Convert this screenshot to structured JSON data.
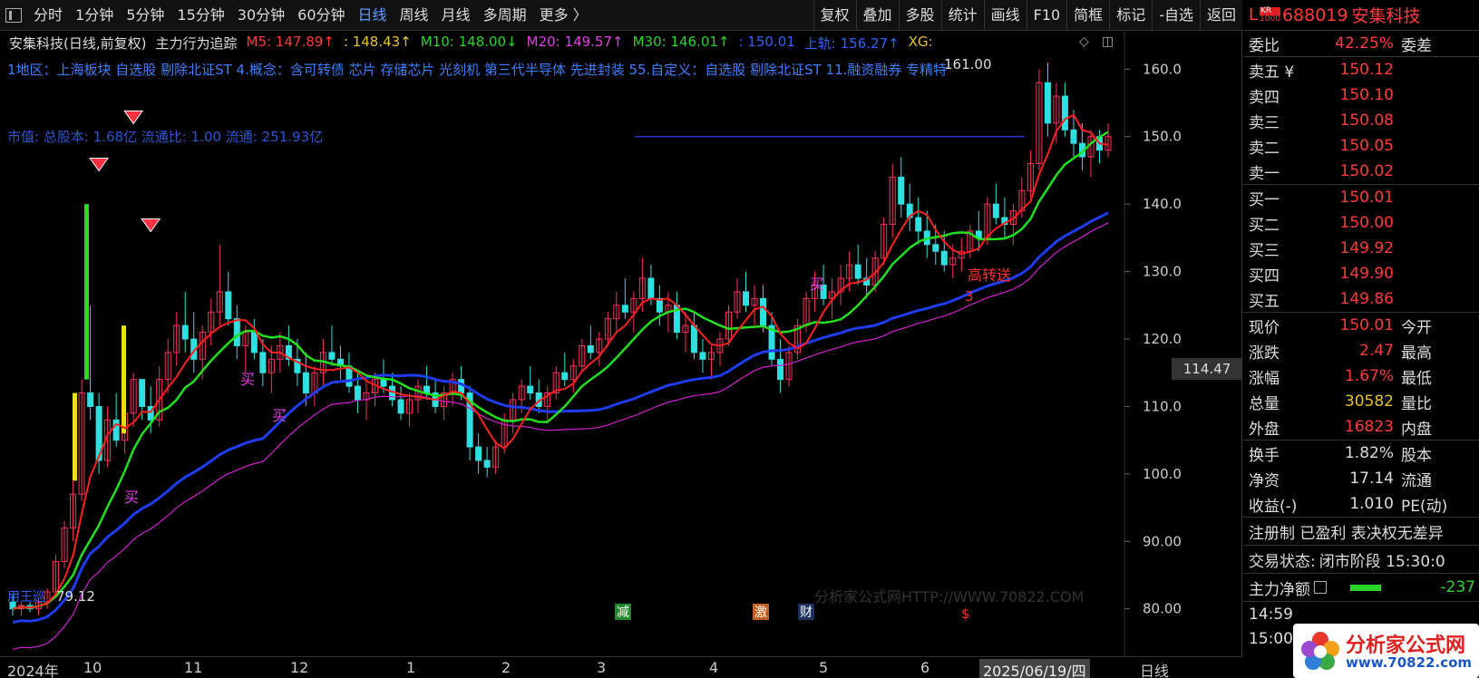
{
  "toolbar": {
    "left": [
      "分时",
      "1分钟",
      "5分钟",
      "15分钟",
      "30分钟",
      "60分钟",
      "日线",
      "周线",
      "月线",
      "多周期",
      "更多 〉"
    ],
    "active": "日线",
    "right": [
      "复权",
      "叠加",
      "多股",
      "统计",
      "画线",
      "F10",
      "简框",
      "标记",
      "-自选",
      "返回"
    ]
  },
  "legend": {
    "stock": "安集科技(日线,前复权)",
    "indicator": "主力行为追踪",
    "m5": "M5: 147.89↑",
    "m_unnamed": ": 148.43↑",
    "m10": "M10: 148.00↓",
    "m20": "M20: 149.57↑",
    "m30": "M30: 146.01↑",
    "val": ": 150.01",
    "upper": "上轨: 156.27↑",
    "xg": "XG:"
  },
  "concept_text": "1地区：上海板块  自选股  剔除北证ST  4.概念：含可转债  芯片  存储芯片  光刻机  第三代半导体  先进封装  55.自定义：自选股  剔除北证ST  11.融资融券  专精特",
  "cap_text": "市值: 总股本: 1.68亿 流通比: 1.00 流通: 251.93亿",
  "annotations": {
    "high_label": "161.00",
    "low_label": "79.12",
    "low_prefix": "用王巡",
    "buy": "买",
    "gzs": "高转送",
    "gzs_num": "3",
    "watermark": "分析家公式网HTTP://WWW.70822.COM",
    "event_jian": "减",
    "event_ji": "激",
    "event_cai": "财",
    "event_dollar": "$"
  },
  "price_tag": "114.47",
  "yaxis": [
    "160.0",
    "150.0",
    "140.0",
    "130.0",
    "120.0",
    "110.0",
    "100.0",
    "90.00",
    "80.00"
  ],
  "xaxis": {
    "labels": [
      "2024年",
      "10",
      "11",
      "12",
      "1",
      "2",
      "3",
      "4",
      "5",
      "6"
    ],
    "date": "2025/06/19/四",
    "period": "日线"
  },
  "panel": {
    "code_prefix": "L",
    "code_badge": "KR",
    "code_sub": "1000",
    "code": "688019",
    "name": "安集科技",
    "weibi_label": "委比",
    "weibi_val": "42.25%",
    "weicha_label": "委差",
    "sells": [
      {
        "label": "卖五 ¥",
        "price": "150.12"
      },
      {
        "label": "卖四",
        "price": "150.10"
      },
      {
        "label": "卖三",
        "price": "150.08"
      },
      {
        "label": "卖二",
        "price": "150.05"
      },
      {
        "label": "卖一",
        "price": "150.02"
      }
    ],
    "buys": [
      {
        "label": "买一",
        "price": "150.01"
      },
      {
        "label": "买二",
        "price": "150.00"
      },
      {
        "label": "买三",
        "price": "149.92"
      },
      {
        "label": "买四",
        "price": "149.90"
      },
      {
        "label": "买五",
        "price": "149.86"
      }
    ],
    "quote": [
      {
        "label": "现价",
        "val": "150.01",
        "cls": "red",
        "label2": "今开"
      },
      {
        "label": "涨跌",
        "val": "2.47",
        "cls": "red",
        "label2": "最高"
      },
      {
        "label": "涨幅",
        "val": "1.67%",
        "cls": "red",
        "label2": "最低"
      },
      {
        "label": "总量",
        "val": "30582",
        "cls": "yellow",
        "label2": "量比"
      },
      {
        "label": "外盘",
        "val": "16823",
        "cls": "red",
        "label2": "内盘"
      }
    ],
    "fin": [
      {
        "label": "换手",
        "val": "1.82%",
        "label2": "股本"
      },
      {
        "label": "净资",
        "val": "17.14",
        "label2": "流通"
      },
      {
        "label": "收益(-)",
        "val": "1.010",
        "label2": "PE(动)"
      }
    ],
    "tags": "注册制 已盈利 表决权无差异",
    "status_label": "交易状态:",
    "status_val": "闭市阶段 15:30:0",
    "flow_label": "主力净额",
    "flow_val": "-237",
    "time1": "14:59",
    "time2": "15:00"
  },
  "logo": {
    "title": "分析家公式网",
    "url": "www.70822.com"
  },
  "chart_data": {
    "type": "candlestick",
    "ylim": [
      77,
      163
    ],
    "candles": [
      [
        81,
        82,
        79,
        80
      ],
      [
        80,
        81,
        79,
        80.5
      ],
      [
        80.5,
        81,
        79.5,
        80
      ],
      [
        80,
        81.5,
        79.12,
        81
      ],
      [
        81,
        83,
        80,
        82.5
      ],
      [
        82.5,
        88,
        82,
        87
      ],
      [
        87,
        93,
        86,
        92
      ],
      [
        92,
        99,
        90,
        97
      ],
      [
        97,
        114,
        96,
        112
      ],
      [
        112,
        125,
        108,
        110
      ],
      [
        110,
        112,
        100,
        102
      ],
      [
        102,
        110,
        101,
        108
      ],
      [
        108,
        112,
        104,
        105
      ],
      [
        105,
        110,
        103,
        109
      ],
      [
        109,
        115,
        107,
        114
      ],
      [
        114,
        112,
        108,
        110
      ],
      [
        110,
        113,
        106,
        108
      ],
      [
        108,
        116,
        107,
        114
      ],
      [
        114,
        120,
        112,
        118
      ],
      [
        118,
        124,
        116,
        122
      ],
      [
        122,
        127,
        118,
        120
      ],
      [
        120,
        124,
        115,
        117
      ],
      [
        117,
        122,
        114,
        121
      ],
      [
        121,
        126,
        119,
        124
      ],
      [
        124,
        134,
        122,
        127
      ],
      [
        127,
        130,
        122,
        123
      ],
      [
        123,
        125,
        117,
        119
      ],
      [
        119,
        122,
        115,
        121
      ],
      [
        121,
        123,
        117,
        118
      ],
      [
        118,
        120,
        113,
        115
      ],
      [
        115,
        119,
        112,
        117
      ],
      [
        117,
        121,
        115,
        119
      ],
      [
        119,
        122,
        116,
        117
      ],
      [
        117,
        120,
        113,
        115
      ],
      [
        115,
        118,
        110,
        112
      ],
      [
        112,
        116,
        110,
        115
      ],
      [
        115,
        120,
        113,
        118
      ],
      [
        118,
        122,
        116,
        117
      ],
      [
        117,
        119,
        114,
        116
      ],
      [
        116,
        118,
        112,
        113
      ],
      [
        113,
        115,
        109,
        111
      ],
      [
        111,
        114,
        108,
        112
      ],
      [
        112,
        115,
        110,
        114
      ],
      [
        114,
        117,
        112,
        113
      ],
      [
        113,
        115,
        110,
        111
      ],
      [
        111,
        113,
        108,
        109
      ],
      [
        109,
        112,
        107,
        111
      ],
      [
        111,
        114,
        109,
        113
      ],
      [
        113,
        116,
        111,
        112
      ],
      [
        112,
        114,
        109,
        110
      ],
      [
        110,
        113,
        108,
        112
      ],
      [
        112,
        115,
        110,
        114
      ],
      [
        114,
        116,
        111,
        112
      ],
      [
        112,
        113,
        102,
        104
      ],
      [
        104,
        106,
        100,
        102
      ],
      [
        102,
        104,
        99.5,
        101
      ],
      [
        101,
        105,
        100,
        104
      ],
      [
        104,
        109,
        103,
        108
      ],
      [
        108,
        112,
        106,
        111
      ],
      [
        111,
        114,
        109,
        113
      ],
      [
        113,
        116,
        111,
        112
      ],
      [
        112,
        114,
        109,
        110
      ],
      [
        110,
        113,
        108,
        112
      ],
      [
        112,
        116,
        111,
        115
      ],
      [
        115,
        118,
        113,
        114
      ],
      [
        114,
        117,
        112,
        116
      ],
      [
        116,
        120,
        115,
        119
      ],
      [
        119,
        122,
        117,
        118
      ],
      [
        118,
        121,
        116,
        120
      ],
      [
        120,
        124,
        119,
        123
      ],
      [
        123,
        127,
        121,
        125
      ],
      [
        125,
        129,
        123,
        124
      ],
      [
        124,
        127,
        121,
        126
      ],
      [
        126,
        132,
        124,
        129
      ],
      [
        129,
        131,
        125,
        126
      ],
      [
        126,
        128,
        122,
        124
      ],
      [
        124,
        127,
        121,
        125
      ],
      [
        125,
        127,
        120,
        121
      ],
      [
        121,
        124,
        118,
        122
      ],
      [
        122,
        124,
        117,
        118
      ],
      [
        118,
        120,
        115,
        117
      ],
      [
        117,
        119,
        114,
        118
      ],
      [
        118,
        121,
        116,
        120
      ],
      [
        120,
        125,
        119,
        124
      ],
      [
        124,
        129,
        123,
        127
      ],
      [
        127,
        130,
        124,
        125
      ],
      [
        125,
        128,
        122,
        126
      ],
      [
        126,
        128,
        121,
        122
      ],
      [
        122,
        124,
        116,
        117
      ],
      [
        117,
        120,
        112,
        114
      ],
      [
        114,
        119,
        113,
        118
      ],
      [
        118,
        123,
        117,
        122
      ],
      [
        122,
        127,
        121,
        126
      ],
      [
        126,
        130,
        124,
        128
      ],
      [
        128,
        131,
        125,
        126
      ],
      [
        126,
        129,
        123,
        127
      ],
      [
        127,
        131,
        125,
        129
      ],
      [
        129,
        133,
        127,
        131
      ],
      [
        131,
        134,
        128,
        129
      ],
      [
        129,
        132,
        126,
        128
      ],
      [
        128,
        133,
        127,
        132
      ],
      [
        132,
        138,
        131,
        137
      ],
      [
        137,
        146,
        135,
        144
      ],
      [
        144,
        147,
        138,
        140
      ],
      [
        140,
        143,
        136,
        138
      ],
      [
        138,
        141,
        134,
        136
      ],
      [
        136,
        139,
        132,
        134
      ],
      [
        134,
        137,
        131,
        133
      ],
      [
        133,
        136,
        130,
        131
      ],
      [
        131,
        134,
        129,
        132
      ],
      [
        132,
        135,
        130,
        133
      ],
      [
        133,
        137,
        132,
        136
      ],
      [
        136,
        139,
        133,
        135
      ],
      [
        135,
        141,
        134,
        140
      ],
      [
        140,
        143,
        137,
        138
      ],
      [
        138,
        141,
        135,
        137
      ],
      [
        137,
        140,
        134,
        139
      ],
      [
        139,
        144,
        138,
        142
      ],
      [
        142,
        148,
        141,
        146
      ],
      [
        146,
        160,
        145,
        158
      ],
      [
        158,
        161,
        150,
        152
      ],
      [
        152,
        158,
        149,
        156
      ],
      [
        156,
        158,
        150,
        151
      ],
      [
        151,
        154,
        147,
        149
      ],
      [
        149,
        152,
        145,
        147
      ],
      [
        147,
        151,
        144,
        150
      ],
      [
        150,
        151,
        146,
        148
      ],
      [
        148,
        152,
        147,
        150.01
      ]
    ],
    "markers": [
      {
        "type": "gem",
        "i": 14,
        "y": 153
      },
      {
        "type": "gem",
        "i": 10,
        "y": 146
      },
      {
        "type": "gem",
        "i": 16,
        "y": 137
      }
    ]
  }
}
